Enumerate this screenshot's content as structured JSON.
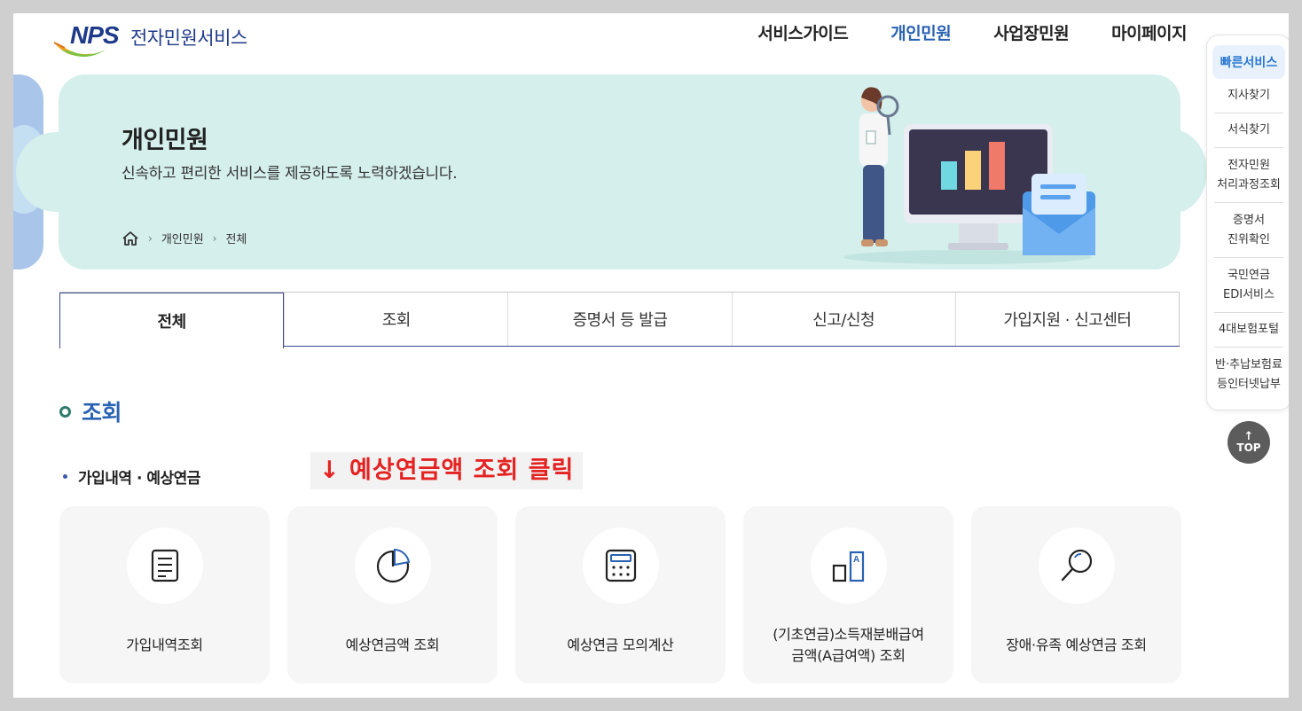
{
  "header": {
    "logo_mark": "NPS",
    "logo_text": "전자민원서비스",
    "nav": [
      {
        "label": "서비스가이드",
        "active": false
      },
      {
        "label": "개인민원",
        "active": true
      },
      {
        "label": "사업장민원",
        "active": false
      },
      {
        "label": "마이페이지",
        "active": false
      }
    ]
  },
  "banner": {
    "title": "개인민원",
    "subtitle": "신속하고 편리한 서비스를 제공하도록 노력하겠습니다.",
    "breadcrumb": [
      "개인민원",
      "전체"
    ]
  },
  "tabs": [
    {
      "label": "전체",
      "active": true
    },
    {
      "label": "조회",
      "active": false
    },
    {
      "label": "증명서 등 발급",
      "active": false
    },
    {
      "label": "신고/신청",
      "active": false
    },
    {
      "label": "가입지원 · 신고센터",
      "active": false
    }
  ],
  "section": {
    "title": "조회",
    "subsection": "가입내역 · 예상연금",
    "annotation": "↓ 예상연금액 조회 클릭"
  },
  "cards": [
    {
      "icon": "document-icon",
      "line1": "가입내역조회",
      "line2": ""
    },
    {
      "icon": "pie-chart-icon",
      "line1": "예상연금액 조회",
      "line2": ""
    },
    {
      "icon": "calculator-icon",
      "line1": "예상연금 모의계산",
      "line2": ""
    },
    {
      "icon": "a-benefit-icon",
      "line1": "(기초연금)소득재분배급여",
      "line2": "금액(A급여액) 조회"
    },
    {
      "icon": "magnifier-icon",
      "line1": "장애·유족 예상연금 조회",
      "line2": ""
    }
  ],
  "quick_menu": {
    "title": "빠른서비스",
    "items": [
      {
        "line1": "지사찾기",
        "line2": ""
      },
      {
        "line1": "서식찾기",
        "line2": ""
      },
      {
        "line1": "전자민원",
        "line2": "처리과정조회"
      },
      {
        "line1": "증명서",
        "line2": "진위확인"
      },
      {
        "line1": "국민연금",
        "line2": "EDI서비스"
      },
      {
        "line1": "4대보험포털",
        "line2": ""
      },
      {
        "line1": "반·추납보험료",
        "line2": "등인터넷납부"
      }
    ],
    "top_label": "TOP",
    "top_arrow": "↑"
  },
  "colors": {
    "accent": "#2a62b3",
    "banner_bg": "#d5efec",
    "annotation": "#e52222"
  }
}
